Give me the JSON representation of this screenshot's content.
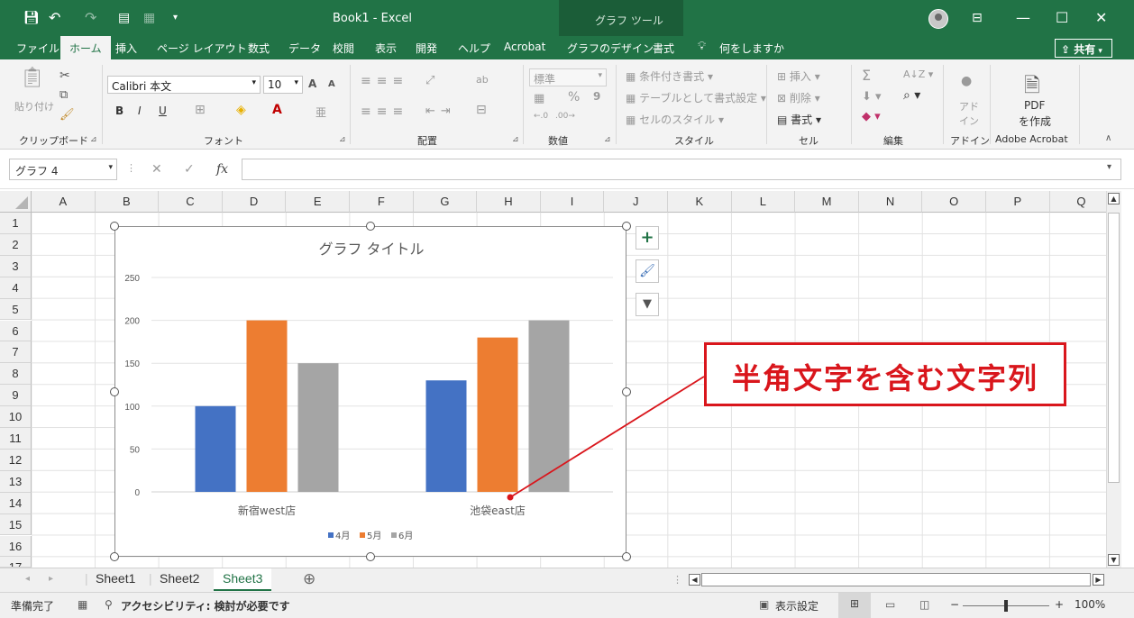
{
  "window": {
    "title": "Book1  -  Excel",
    "context_tool": "グラフ ツール",
    "icons": [
      "save-icon",
      "undo-icon",
      "redo-icon",
      "print-preview-icon",
      "form-icon",
      "customize-qat-icon",
      "avatar-icon",
      "ribbon-display-icon",
      "minimize-icon",
      "restore-icon",
      "close-icon"
    ],
    "window_buttons": [
      "—",
      "☐",
      "✕"
    ]
  },
  "tabs": [
    {
      "label": "ファイル"
    },
    {
      "label": "ホーム"
    },
    {
      "label": "挿入"
    },
    {
      "label": "ページ レイアウト"
    },
    {
      "label": "数式"
    },
    {
      "label": "データ"
    },
    {
      "label": "校閲"
    },
    {
      "label": "表示"
    },
    {
      "label": "開発"
    },
    {
      "label": "ヘルプ"
    },
    {
      "label": "Acrobat"
    },
    {
      "label": "グラフのデザイン"
    },
    {
      "label": "書式"
    },
    {
      "label": "何をしますか"
    }
  ],
  "share_label": "共有",
  "ribbon": {
    "clipboard": {
      "paste": "貼り付け",
      "group": "クリップボード"
    },
    "font": {
      "name": "Calibri 本文",
      "size": "10",
      "bold": "B",
      "italic": "I",
      "underline": "U",
      "group": "フォント",
      "grow": "A",
      "shrink": "A"
    },
    "alignment": {
      "group": "配置"
    },
    "number": {
      "format": "標準",
      "percent": "%",
      "comma": "9",
      "group": "数値"
    },
    "styles": {
      "conditional": "条件付き書式",
      "table": "テーブルとして書式設定",
      "cell": "セルのスタイル",
      "group": "スタイル"
    },
    "cells": {
      "insert": "挿入",
      "delete": "削除",
      "format": "書式",
      "group": "セル"
    },
    "editing": {
      "group": "編集",
      "sum": "Σ"
    },
    "addins": {
      "label1": "アド",
      "label2": "イン",
      "group": "アドイン"
    },
    "acrobat": {
      "label1": "PDF",
      "label2": "を作成",
      "group": "Adobe Acrobat"
    }
  },
  "formula_bar": {
    "name_box": "グラフ 4",
    "fx": "fx",
    "cancel": "✕",
    "enter": "✓",
    "value": ""
  },
  "columns": [
    "A",
    "B",
    "C",
    "D",
    "E",
    "F",
    "G",
    "H",
    "I",
    "J",
    "K",
    "L",
    "M",
    "N",
    "O",
    "P",
    "Q"
  ],
  "rows": [
    "1",
    "2",
    "3",
    "4",
    "5",
    "6",
    "7",
    "8",
    "9",
    "10",
    "11",
    "12",
    "13",
    "14",
    "15",
    "16",
    "17"
  ],
  "chart_data": {
    "type": "bar",
    "title": "グラフ タイトル",
    "categories": [
      "新宿west店",
      "池袋east店"
    ],
    "series": [
      {
        "name": "4月",
        "values": [
          100,
          130
        ],
        "color": "#4472c4"
      },
      {
        "name": "5月",
        "values": [
          200,
          180
        ],
        "color": "#ed7d31"
      },
      {
        "name": "6月",
        "values": [
          150,
          200
        ],
        "color": "#a5a5a5"
      }
    ],
    "y_ticks": [
      "0",
      "50",
      "100",
      "150",
      "200",
      "250"
    ],
    "ylim": [
      0,
      250
    ],
    "grid": true,
    "legend": "bottom"
  },
  "chart_buttons": [
    "add-element-icon",
    "brush-style-icon",
    "filter-icon"
  ],
  "annotation": {
    "text": "半角文字を含む文字列",
    "color": "#d9161c"
  },
  "sheets": [
    {
      "label": "Sheet1"
    },
    {
      "label": "Sheet2"
    },
    {
      "label": "Sheet3"
    }
  ],
  "add_sheet": "⊕",
  "status": {
    "ready": "準備完了",
    "accessibility": "アクセシビリティ: 検討が必要です",
    "display_settings": "表示設定",
    "zoom": "100%",
    "zoom_level": 1.0
  }
}
